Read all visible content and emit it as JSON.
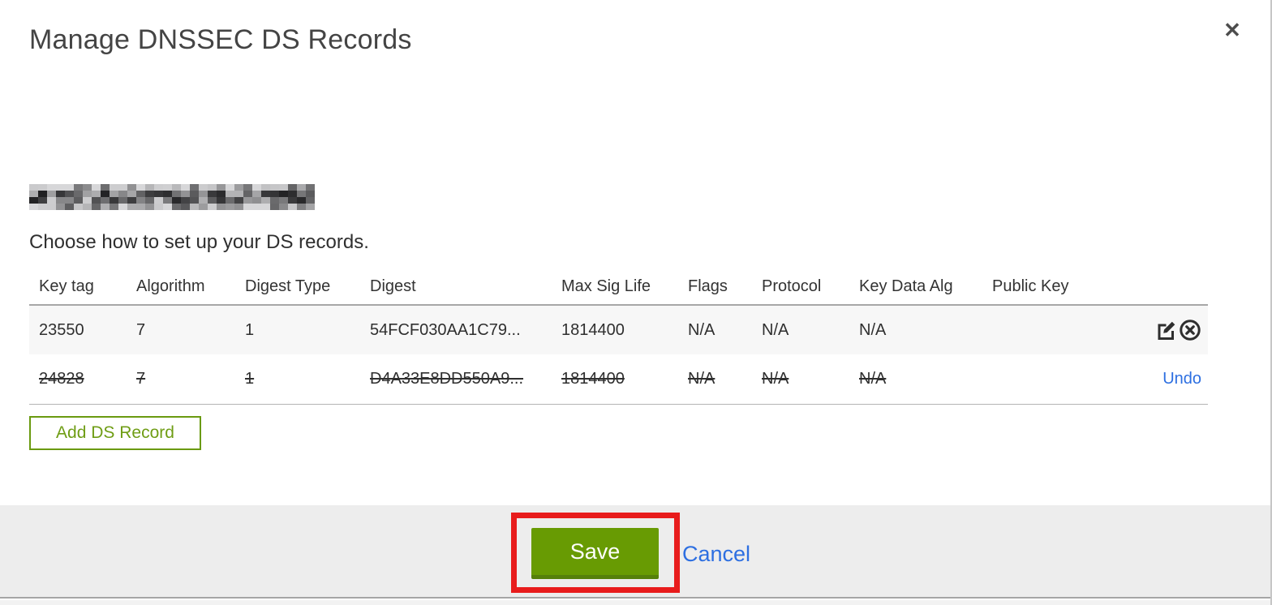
{
  "modal": {
    "title": "Manage DNSSEC DS Records",
    "subtitle": "Choose how to set up your DS records.",
    "close_glyph": "✕",
    "domain_redacted": true
  },
  "table": {
    "columns": [
      "Key tag",
      "Algorithm",
      "Digest Type",
      "Digest",
      "Max Sig Life",
      "Flags",
      "Protocol",
      "Key Data Alg",
      "Public Key"
    ],
    "rows": [
      {
        "cells": [
          "23550",
          "7",
          "1",
          "54FCF030AA1C79...",
          "1814400",
          "N/A",
          "N/A",
          "N/A",
          ""
        ],
        "state": "existing",
        "actions": [
          "edit-icon",
          "delete-icon"
        ]
      },
      {
        "cells": [
          "24828",
          "7",
          "1",
          "D4A33E8DD550A9...",
          "1814400",
          "N/A",
          "N/A",
          "N/A",
          ""
        ],
        "state": "marked-for-deletion",
        "undo_label": "Undo"
      }
    ]
  },
  "buttons": {
    "add_ds_record": "Add DS Record",
    "save": "Save",
    "cancel": "Cancel"
  },
  "icons": {
    "close": "bold-x-cross",
    "edit": "pencil-on-square",
    "delete": "x-in-circle"
  },
  "colors": {
    "accent_green": "#689b03",
    "green_border": "#6a9a10",
    "link_blue": "#2d6fe1",
    "annotation_red": "#e81c1c",
    "row_gray": "#f7f7f7",
    "footer_gray": "#ededed"
  }
}
